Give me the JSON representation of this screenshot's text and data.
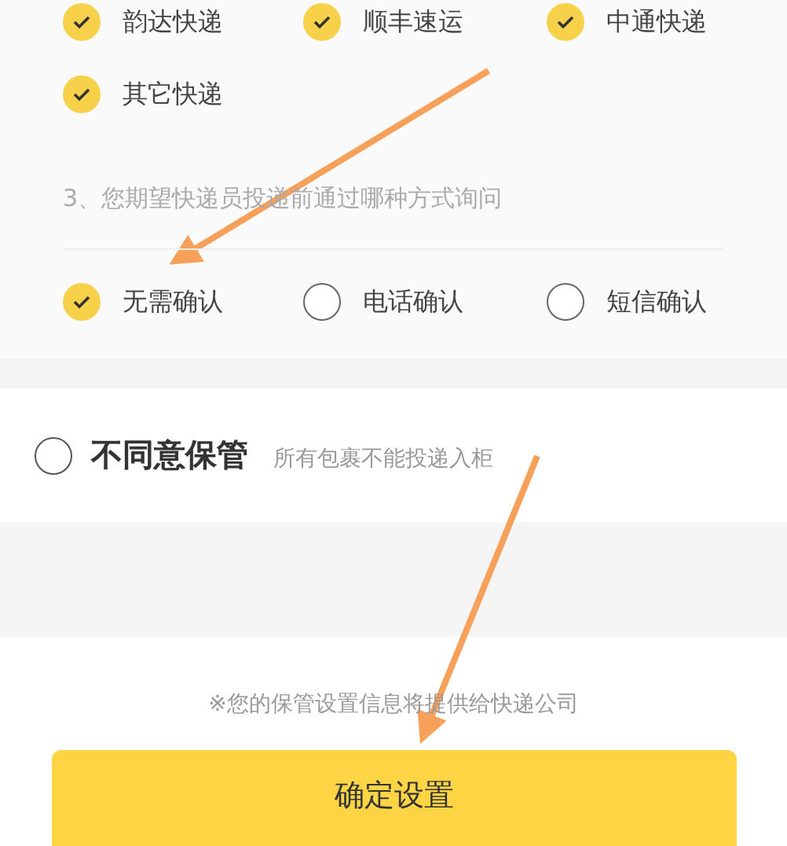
{
  "carriers": [
    {
      "label": "韵达快递",
      "checked": true
    },
    {
      "label": "顺丰速运",
      "checked": true
    },
    {
      "label": "中通快递",
      "checked": true
    },
    {
      "label": "其它快递",
      "checked": true
    }
  ],
  "question": "3、您期望快递员投递前通过哪种方式询问",
  "confirm_methods": [
    {
      "label": "无需确认",
      "selected": true
    },
    {
      "label": "电话确认",
      "selected": false
    },
    {
      "label": "短信确认",
      "selected": false
    }
  ],
  "disagree_option": {
    "label": "不同意保管",
    "description": "所有包裹不能投递入柜",
    "selected": false
  },
  "note": "※您的保管设置信息将提供给快递公司",
  "confirm_button": "确定设置"
}
